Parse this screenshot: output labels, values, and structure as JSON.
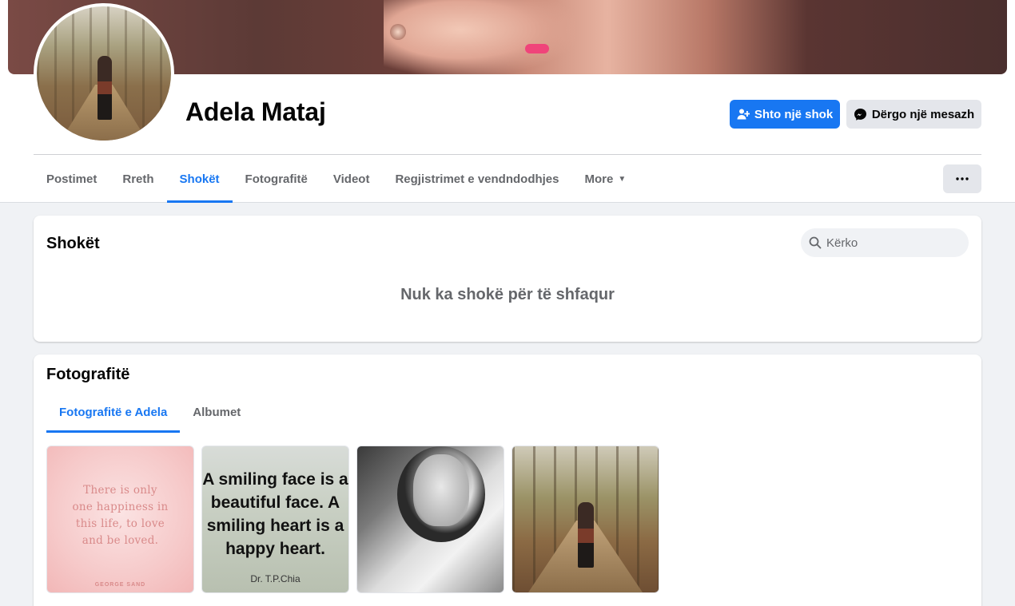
{
  "profile": {
    "name": "Adela Mataj",
    "add_friend_label": "Shto një shok",
    "message_label": "Dërgo një mesazh"
  },
  "nav": {
    "tabs": [
      {
        "label": "Postimet",
        "active": false
      },
      {
        "label": "Rreth",
        "active": false
      },
      {
        "label": "Shokët",
        "active": true
      },
      {
        "label": "Fotografitë",
        "active": false
      },
      {
        "label": "Videot",
        "active": false
      },
      {
        "label": "Regjistrimet e vendndodhjes",
        "active": false
      },
      {
        "label": "More",
        "active": false
      }
    ],
    "more_options_icon": "ellipsis-icon"
  },
  "friends": {
    "title": "Shokët",
    "search_placeholder": "Kërko",
    "empty_text": "Nuk ka shokë për të shfaqur"
  },
  "photos": {
    "title": "Fotografitë",
    "tabs": [
      {
        "label": "Fotografitë e Adela",
        "active": true
      },
      {
        "label": "Albumet",
        "active": false
      }
    ],
    "items": [
      {
        "quote": "There is only\none happiness in\nthis life, to love\nand be loved.",
        "author": "GEORGE SAND"
      },
      {
        "quote": "A smiling face is a\nbeautiful face. A\nsmiling heart is a\nhappy heart.",
        "author": "Dr. T.P.Chia"
      },
      {
        "quote": "",
        "author": ""
      },
      {
        "quote": "",
        "author": ""
      }
    ]
  },
  "colors": {
    "accent": "#1877f2",
    "background": "#f0f2f5",
    "secondary_button": "#e4e6eb"
  }
}
